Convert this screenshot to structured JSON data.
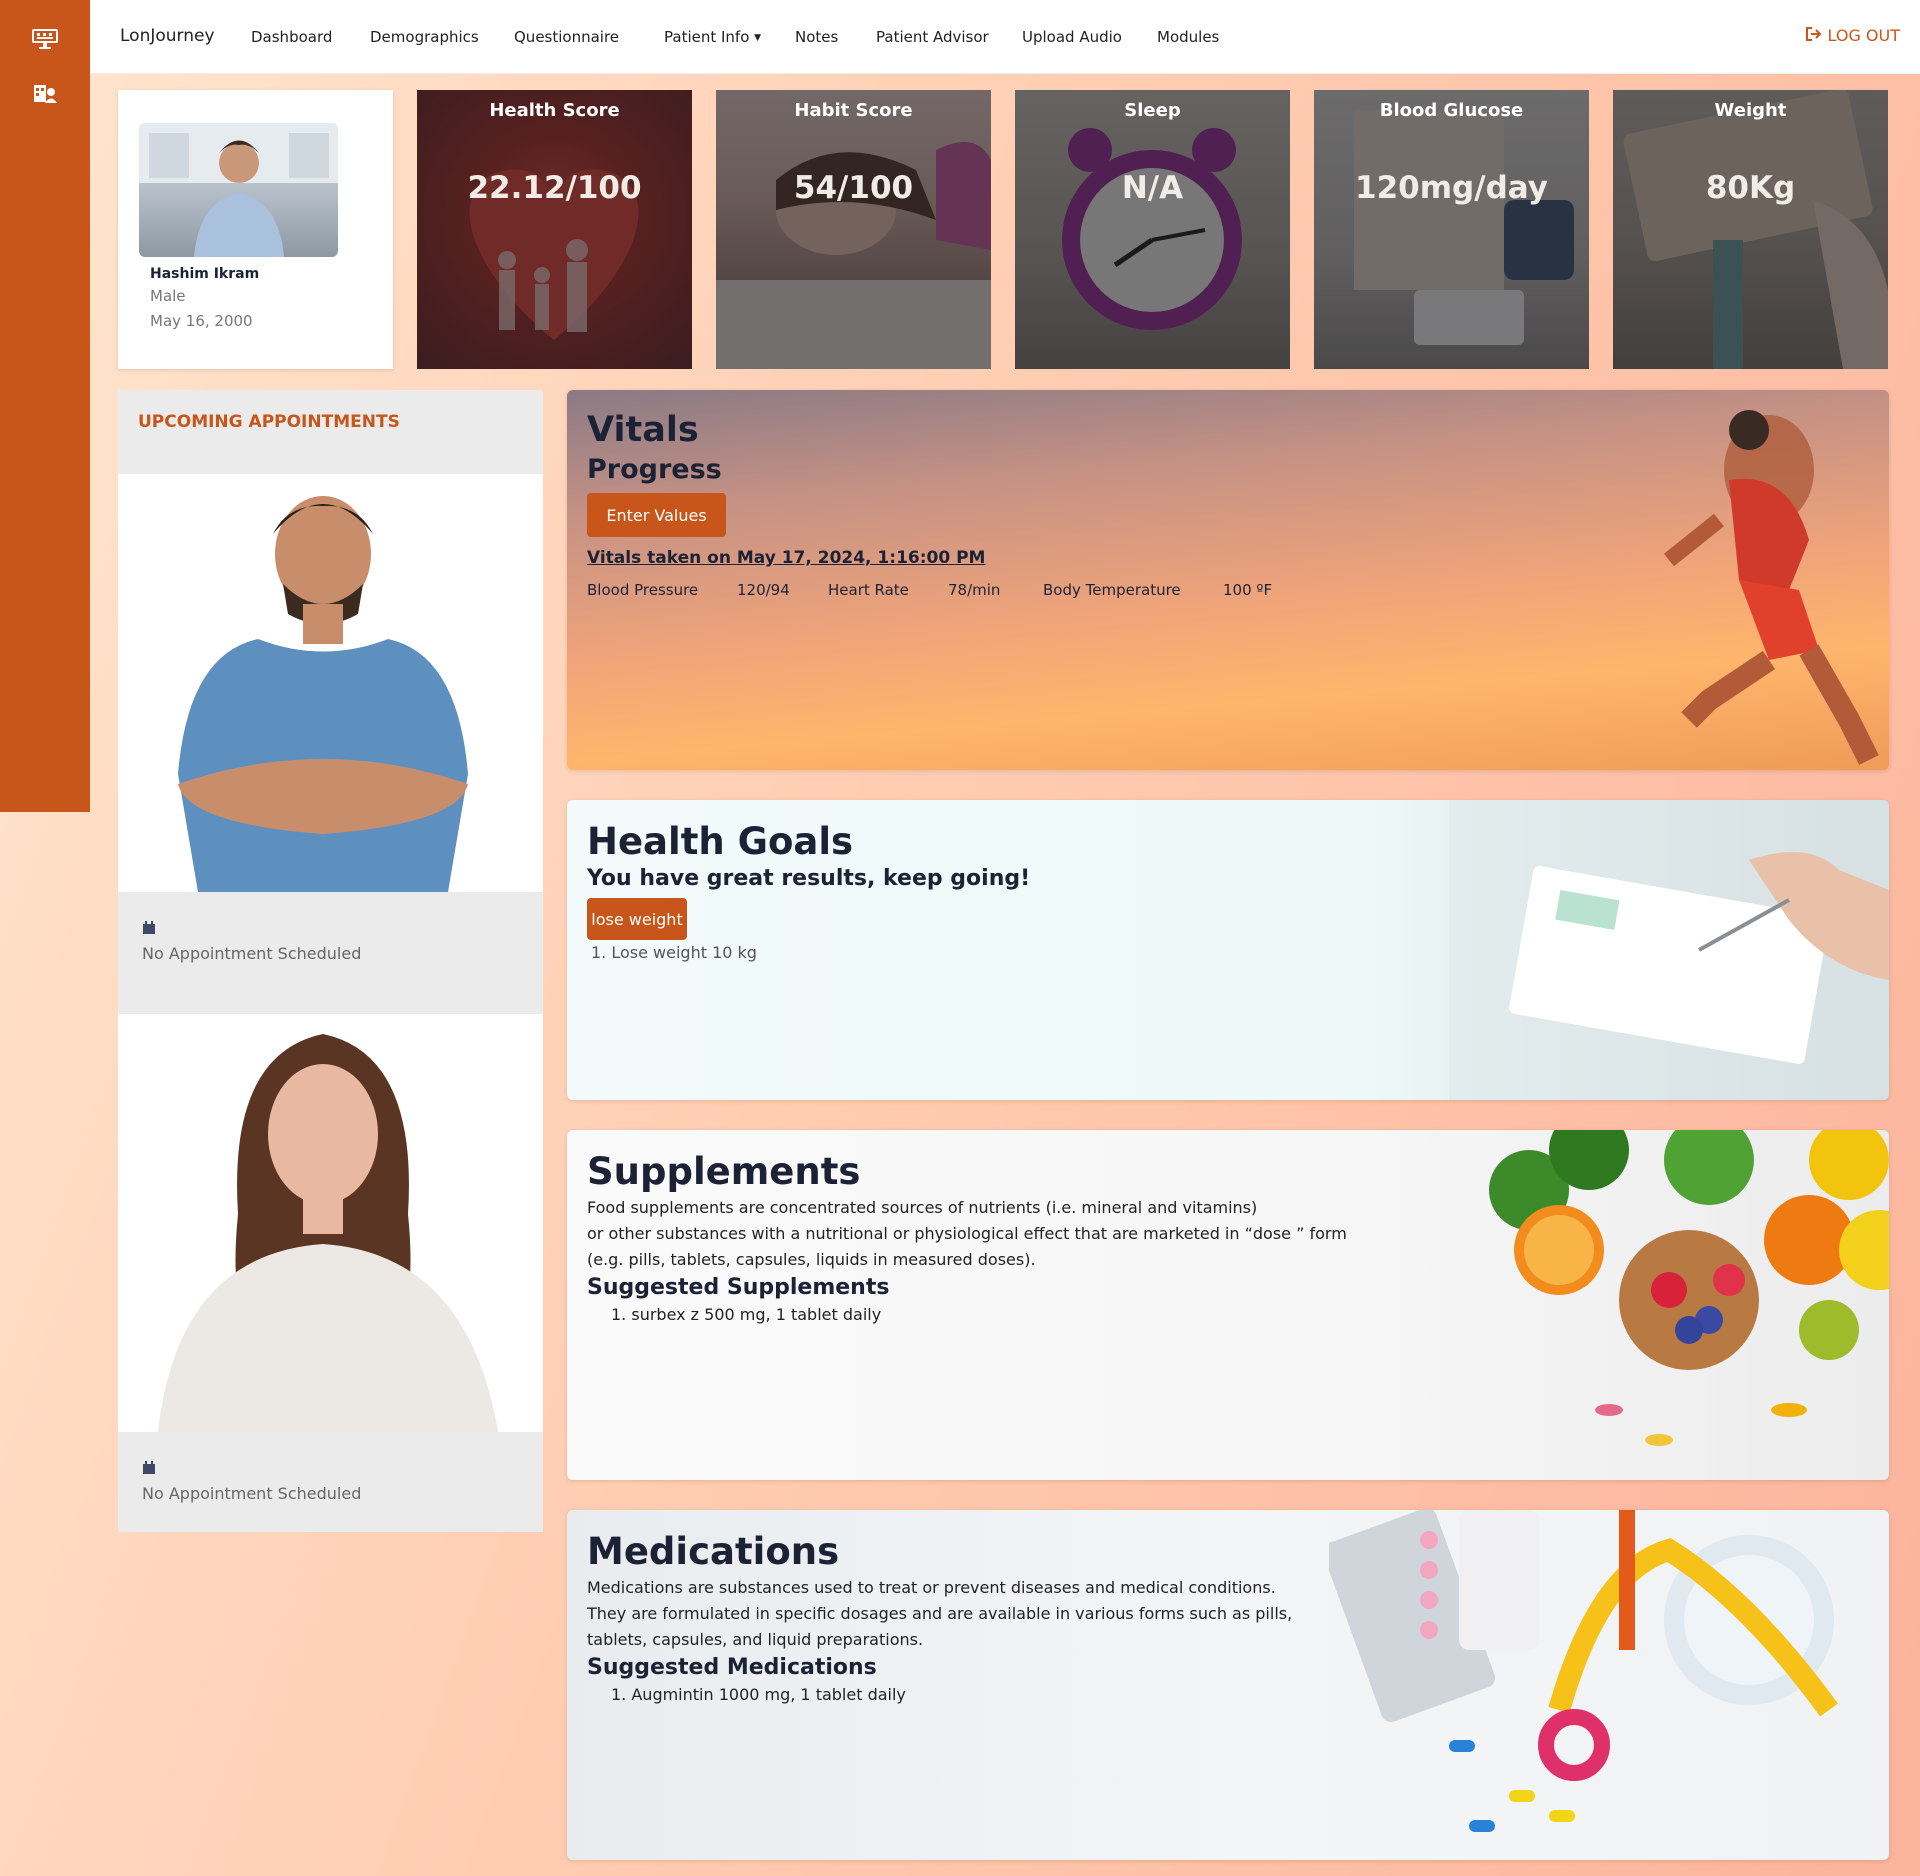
{
  "nav": {
    "brand": "LonJourney",
    "items": [
      "Dashboard",
      "Demographics",
      "Questionnaire",
      "Patient Info",
      "Notes",
      "Patient Advisor",
      "Upload Audio",
      "Modules"
    ],
    "logout": "LOG OUT"
  },
  "profile": {
    "name": "Hashim Ikram",
    "gender": "Male",
    "dob": "May 16, 2000"
  },
  "stats": [
    {
      "title": "Health Score",
      "value": "22.12/100"
    },
    {
      "title": "Habit Score",
      "value": "54/100"
    },
    {
      "title": "Sleep",
      "value": "N/A"
    },
    {
      "title": "Blood Glucose",
      "value": "120mg/day"
    },
    {
      "title": "Weight",
      "value": "80Kg"
    }
  ],
  "appointments": {
    "heading": "UPCOMING APPOINTMENTS",
    "cards": [
      {
        "message": "No Appointment Scheduled"
      },
      {
        "message": "No Appointment Scheduled"
      }
    ]
  },
  "vitals": {
    "title": "Vitals",
    "subtitle": "Progress",
    "button": "Enter Values",
    "taken": "Vitals taken on May 17, 2024, 1:16:00 PM",
    "bp_label": "Blood Pressure",
    "bp_value": "120/94",
    "hr_label": "Heart Rate",
    "hr_value": "78/min",
    "temp_label": "Body Temperature",
    "temp_value": "100 ºF"
  },
  "goals": {
    "title": "Health Goals",
    "subtitle": "You have great results, keep going!",
    "tag": "lose weight",
    "items": [
      "1. Lose weight 10 kg"
    ]
  },
  "supplements": {
    "title": "Supplements",
    "lines": [
      "Food supplements are concentrated sources of nutrients (i.e. mineral and vitamins)",
      "or other substances with a nutritional or physiological effect that are marketed in “dose ” form",
      "(e.g. pills, tablets, capsules, liquids in measured doses)."
    ],
    "suggested_title": "Suggested Supplements",
    "items": [
      "1. surbex z 500 mg, 1 tablet daily"
    ]
  },
  "medications": {
    "title": "Medications",
    "lines": [
      "Medications are substances used to treat or prevent diseases and medical conditions.",
      "They are formulated in specific dosages and are available in various forms such as pills,",
      "tablets, capsules, and liquid preparations."
    ],
    "suggested_title": "Suggested Medications",
    "items": [
      "1. Augmintin 1000 mg, 1 tablet daily"
    ]
  },
  "colors": {
    "accent": "#c8561a",
    "text_dark": "#1c2235"
  }
}
